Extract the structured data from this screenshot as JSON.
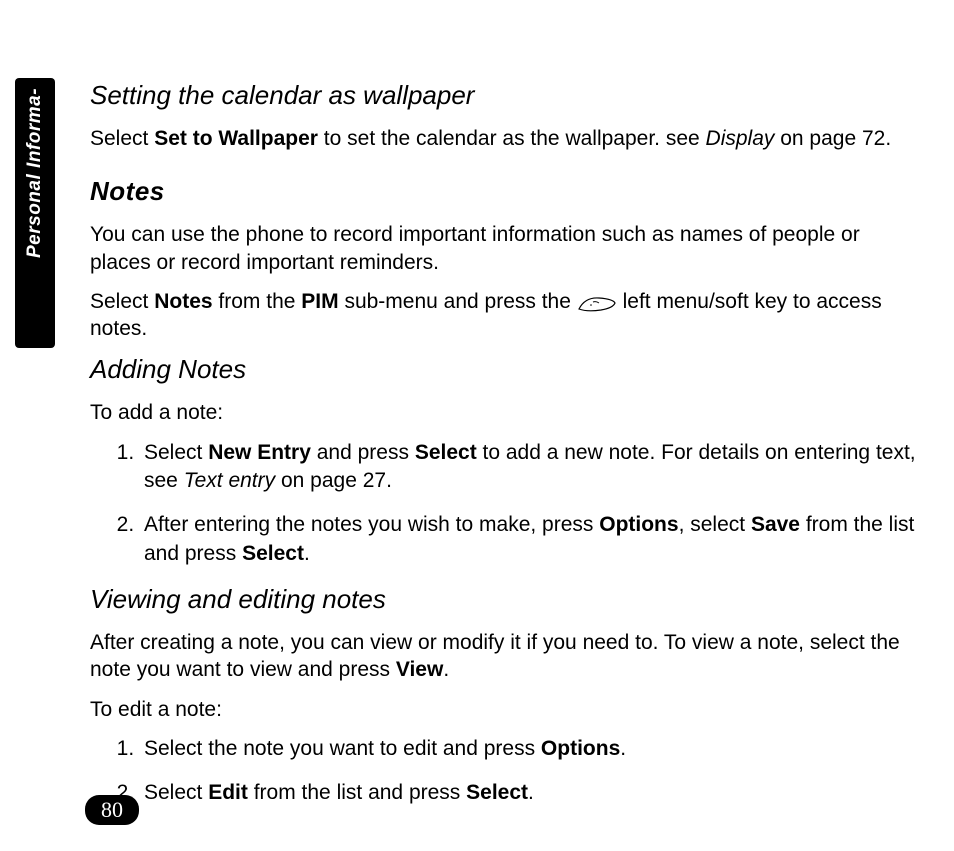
{
  "side_tab": "Personal Informa-",
  "page_number": "80",
  "heading_calendar": "Setting the calendar as wallpaper",
  "para_calendar": {
    "t1": "Select ",
    "b1": "Set to Wallpaper",
    "t2": " to set the calendar as the wallpaper. see ",
    "i1": " Display",
    "t3": " on page 72."
  },
  "section_notes_title": "Notes",
  "para_notes_intro": "You can use the phone to record important information such as names of people or places or record important reminders.",
  "para_notes_access": {
    "t1": "Select ",
    "b1": "Notes",
    "t2": " from the ",
    "b2": "PIM",
    "t3": " sub-menu and press the ",
    "t4": " left menu/soft key to access notes."
  },
  "heading_adding": "Adding Notes",
  "para_add_intro": "To add a note:",
  "add_steps": {
    "s1": {
      "t1": "Select ",
      "b1": "New Entry",
      "t2": " and press ",
      "b2": "Select",
      "t3": " to add a new note. For details on entering text, see ",
      "i1": " Text entry ",
      "t4": " on page 27."
    },
    "s2": {
      "t1": " After entering the notes you wish to make, press ",
      "b1": "Options",
      "t2": ", select ",
      "b2": "Save",
      "t3": " from the list and press ",
      "b3": "Select",
      "t4": "."
    }
  },
  "heading_viewing": "Viewing and editing notes",
  "para_viewing": {
    "t1": "After creating a note, you can view or modify it if you need to. To view a note, select the note you want to view and press ",
    "b1": "View",
    "t2": "."
  },
  "para_edit_intro": "To edit a note:",
  "edit_steps": {
    "s1": {
      "t1": "Select the note you want to edit and press ",
      "b1": "Options",
      "t2": "."
    },
    "s2": {
      "t1": " Select ",
      "b1": "Edit",
      "t2": " from the list and press ",
      "b2": "Select",
      "t3": "."
    }
  }
}
